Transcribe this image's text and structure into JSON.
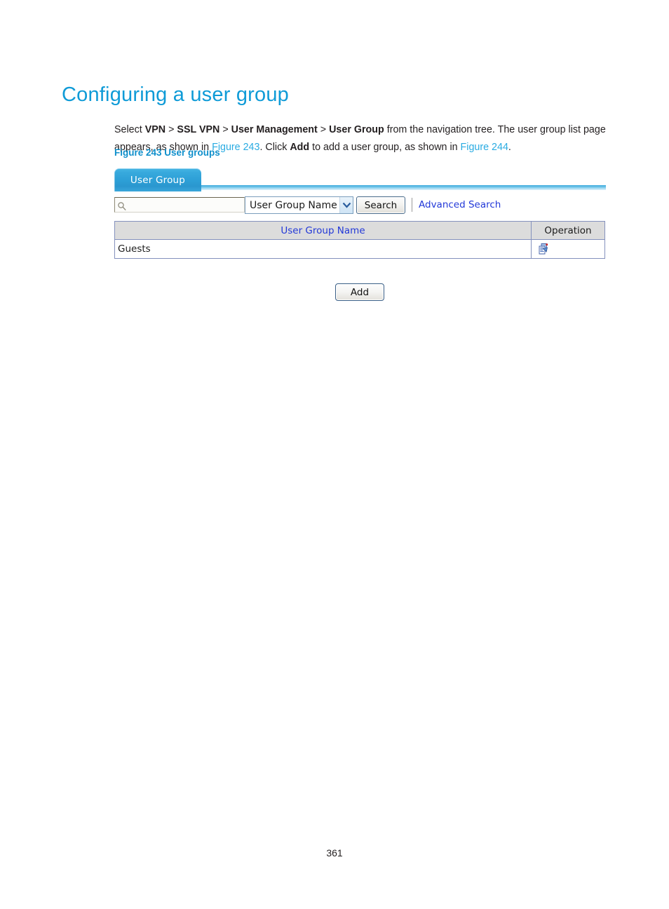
{
  "document": {
    "heading": "Configuring a user group",
    "paragraph": {
      "lead": "Select ",
      "nav_1": "VPN",
      "sep_1": " > ",
      "nav_2": "SSL VPN",
      "sep_2": " > ",
      "nav_3": "User Management",
      "sep_3": " > ",
      "nav_4": "User Group",
      "mid_1": " from the navigation tree. The user group list page appears, as shown in ",
      "xref_1": "Figure 243",
      "mid_2": ". Click ",
      "bold_add": "Add",
      "mid_3": " to add a user group, as shown in ",
      "xref_2": "Figure 244",
      "tail": "."
    },
    "figure_caption": "Figure 243 User groups",
    "page_number": "361"
  },
  "app": {
    "tabs": [
      {
        "label": "User Group",
        "active": true
      }
    ],
    "search": {
      "value": "",
      "placeholder": "",
      "magnifier_icon": "search-icon",
      "filter_selected": "User Group Name",
      "filter_options": [
        "User Group Name"
      ],
      "dropdown_icon": "chevron-down-icon",
      "search_button": "Search",
      "advanced_search_link": "Advanced Search"
    },
    "table": {
      "columns": [
        "User Group Name",
        "Operation"
      ],
      "rows": [
        {
          "user_group_name": "Guests",
          "operation_icon": "edit-copy-icon"
        }
      ]
    },
    "add_button": "Add"
  },
  "colors": {
    "heading_blue": "#0f9bd7",
    "caption_blue": "#0f8fcb",
    "xref_blue": "#29abe2",
    "tab_blue": "#2d9fd6",
    "link_blue": "#2238d8",
    "table_border": "#8491bd",
    "table_header_bg": "#dcdcdc"
  }
}
